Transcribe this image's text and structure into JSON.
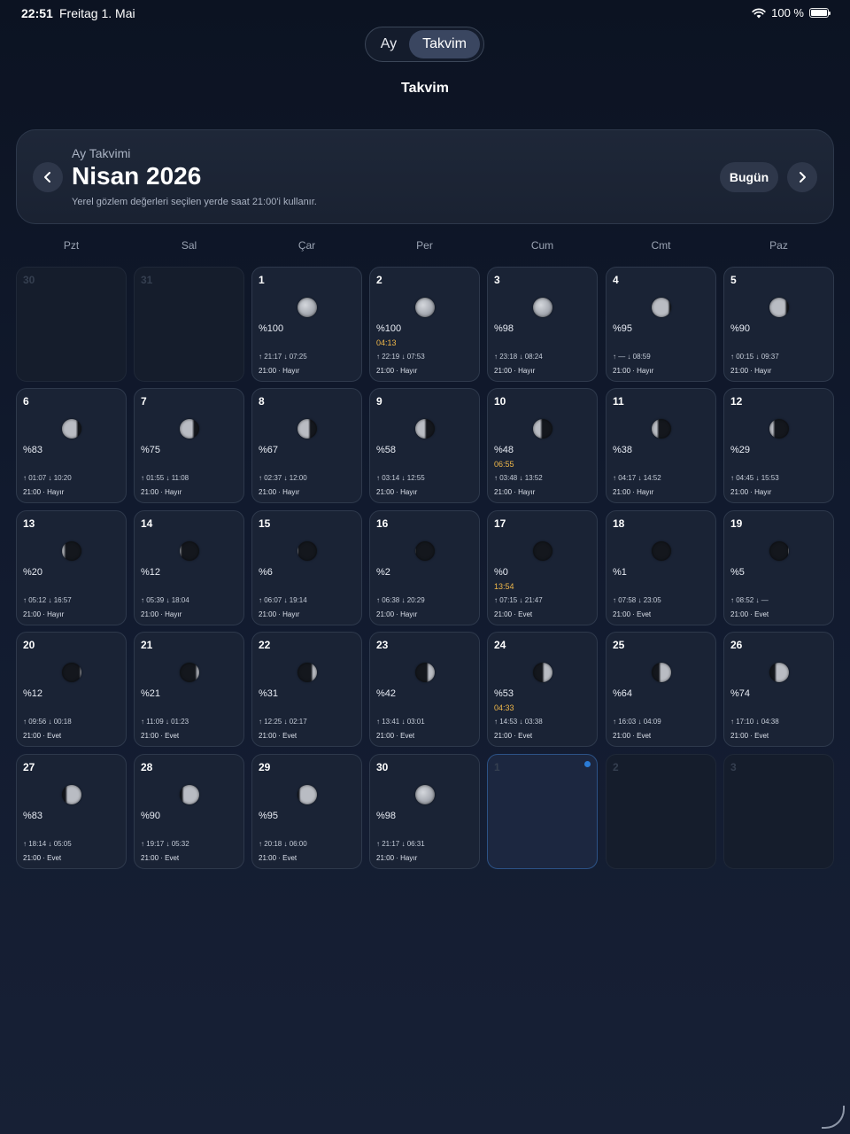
{
  "status": {
    "time": "22:51",
    "date": "Freitag 1. Mai",
    "battery": "100 %",
    "icons": [
      "wifi-icon",
      "battery-icon"
    ]
  },
  "segments": {
    "ay": "Ay",
    "takvim": "Takvim",
    "selected": "Takvim"
  },
  "nav_title": "Takvim",
  "month_card": {
    "subtitle": "Ay Takvimi",
    "title": "Nisan 2026",
    "note": "Yerel gözlem değerleri seçilen yerde saat 21:00'i kullanır.",
    "today": "Bugün",
    "prev_icon": "chevron-left-icon",
    "next_icon": "chevron-right-icon"
  },
  "weekdays": [
    "Pzt",
    "Sal",
    "Çar",
    "Per",
    "Cum",
    "Cmt",
    "Paz"
  ],
  "colors": {
    "phase_time": "#f0b84a",
    "selected_dot": "#2a7bd6",
    "card_bg": "#1a2335"
  },
  "days": [
    {
      "day": "30",
      "outside": true
    },
    {
      "day": "31",
      "outside": true
    },
    {
      "day": "1",
      "illum": "%100",
      "rise": "21:17",
      "set": "07:25",
      "obs": "21:00 · Hayır"
    },
    {
      "day": "2",
      "illum": "%100",
      "phase_time": "04:13",
      "rise": "22:19",
      "set": "07:53",
      "obs": "21:00 · Hayır"
    },
    {
      "day": "3",
      "illum": "%98",
      "rise": "23:18",
      "set": "08:24",
      "obs": "21:00 · Hayır"
    },
    {
      "day": "4",
      "illum": "%95",
      "rise": "—",
      "set": "08:59",
      "obs": "21:00 · Hayır"
    },
    {
      "day": "5",
      "illum": "%90",
      "rise": "00:15",
      "set": "09:37",
      "obs": "21:00 · Hayır"
    },
    {
      "day": "6",
      "illum": "%83",
      "rise": "01:07",
      "set": "10:20",
      "obs": "21:00 · Hayır"
    },
    {
      "day": "7",
      "illum": "%75",
      "rise": "01:55",
      "set": "11:08",
      "obs": "21:00 · Hayır"
    },
    {
      "day": "8",
      "illum": "%67",
      "rise": "02:37",
      "set": "12:00",
      "obs": "21:00 · Hayır"
    },
    {
      "day": "9",
      "illum": "%58",
      "rise": "03:14",
      "set": "12:55",
      "obs": "21:00 · Hayır"
    },
    {
      "day": "10",
      "illum": "%48",
      "phase_time": "06:55",
      "rise": "03:48",
      "set": "13:52",
      "obs": "21:00 · Hayır"
    },
    {
      "day": "11",
      "illum": "%38",
      "rise": "04:17",
      "set": "14:52",
      "obs": "21:00 · Hayır"
    },
    {
      "day": "12",
      "illum": "%29",
      "rise": "04:45",
      "set": "15:53",
      "obs": "21:00 · Hayır"
    },
    {
      "day": "13",
      "illum": "%20",
      "rise": "05:12",
      "set": "16:57",
      "obs": "21:00 · Hayır"
    },
    {
      "day": "14",
      "illum": "%12",
      "rise": "05:39",
      "set": "18:04",
      "obs": "21:00 · Hayır"
    },
    {
      "day": "15",
      "illum": "%6",
      "rise": "06:07",
      "set": "19:14",
      "obs": "21:00 · Hayır"
    },
    {
      "day": "16",
      "illum": "%2",
      "rise": "06:38",
      "set": "20:29",
      "obs": "21:00 · Hayır"
    },
    {
      "day": "17",
      "illum": "%0",
      "phase_time": "13:54",
      "rise": "07:15",
      "set": "21:47",
      "obs": "21:00 · Evet"
    },
    {
      "day": "18",
      "illum": "%1",
      "rise": "07:58",
      "set": "23:05",
      "obs": "21:00 · Evet"
    },
    {
      "day": "19",
      "illum": "%5",
      "rise": "08:52",
      "set": "—",
      "obs": "21:00 · Evet"
    },
    {
      "day": "20",
      "illum": "%12",
      "rise": "09:56",
      "set": "00:18",
      "obs": "21:00 · Evet"
    },
    {
      "day": "21",
      "illum": "%21",
      "rise": "11:09",
      "set": "01:23",
      "obs": "21:00 · Evet"
    },
    {
      "day": "22",
      "illum": "%31",
      "rise": "12:25",
      "set": "02:17",
      "obs": "21:00 · Evet"
    },
    {
      "day": "23",
      "illum": "%42",
      "rise": "13:41",
      "set": "03:01",
      "obs": "21:00 · Evet"
    },
    {
      "day": "24",
      "illum": "%53",
      "phase_time": "04:33",
      "rise": "14:53",
      "set": "03:38",
      "obs": "21:00 · Evet"
    },
    {
      "day": "25",
      "illum": "%64",
      "rise": "16:03",
      "set": "04:09",
      "obs": "21:00 · Evet"
    },
    {
      "day": "26",
      "illum": "%74",
      "rise": "17:10",
      "set": "04:38",
      "obs": "21:00 · Evet"
    },
    {
      "day": "27",
      "illum": "%83",
      "rise": "18:14",
      "set": "05:05",
      "obs": "21:00 · Evet"
    },
    {
      "day": "28",
      "illum": "%90",
      "rise": "19:17",
      "set": "05:32",
      "obs": "21:00 · Evet"
    },
    {
      "day": "29",
      "illum": "%95",
      "rise": "20:18",
      "set": "06:00",
      "obs": "21:00 · Evet"
    },
    {
      "day": "30",
      "illum": "%98",
      "rise": "21:17",
      "set": "06:31",
      "obs": "21:00 · Hayır"
    },
    {
      "day": "1",
      "outside": true,
      "selected": true
    },
    {
      "day": "2",
      "outside": true
    },
    {
      "day": "3",
      "outside": true
    }
  ]
}
